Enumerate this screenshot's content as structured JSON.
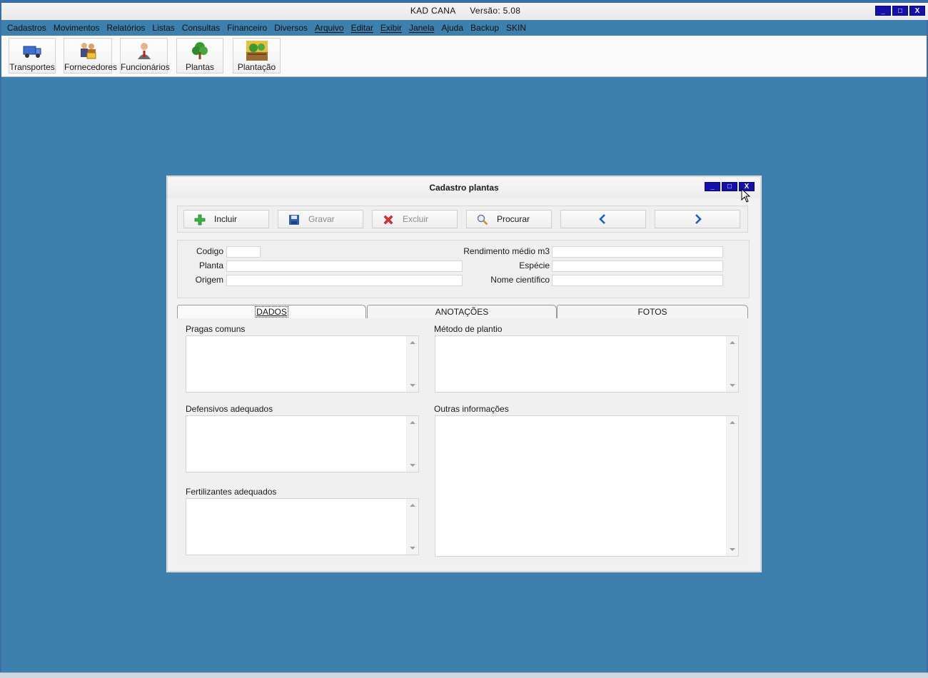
{
  "app": {
    "name": "KAD CANA",
    "version": "Versão: 5.08",
    "controls": {
      "minimize": "_",
      "maximize": "□",
      "close": "X"
    }
  },
  "menu": {
    "items": [
      "Cadastros",
      "Movimentos",
      "Relatórios",
      "Listas",
      "Consultas",
      "Financeiro",
      "Diversos",
      "Arquivo",
      "Editar",
      "Exibir",
      "Janela",
      "Ajuda",
      "Backup",
      "SKIN"
    ]
  },
  "toolbar": {
    "buttons": [
      {
        "label": "Transportes",
        "icon": "truck-icon"
      },
      {
        "label": "Fornecedores",
        "icon": "suppliers-icon"
      },
      {
        "label": "Funcionários",
        "icon": "employee-icon"
      },
      {
        "label": "Plantas",
        "icon": "tree-icon"
      },
      {
        "label": "Plantação",
        "icon": "plantation-icon"
      }
    ]
  },
  "dialog": {
    "title": "Cadastro plantas",
    "actions": {
      "incluir": "Incluir",
      "gravar": "Gravar",
      "excluir": "Excluir",
      "procurar": "Procurar"
    },
    "fields": {
      "codigo": {
        "label": "Codigo",
        "value": ""
      },
      "planta": {
        "label": "Planta",
        "value": ""
      },
      "origem": {
        "label": "Origem",
        "value": ""
      },
      "rendimento": {
        "label": "Rendimento médio m3",
        "value": ""
      },
      "especie": {
        "label": "Espécie",
        "value": ""
      },
      "nome_cientifico": {
        "label": "Nome científico",
        "value": ""
      }
    },
    "tabs": [
      "DADOS",
      "ANOTAÇÕES",
      "FOTOS"
    ],
    "active_tab": "DADOS",
    "dados": {
      "pragas": "Pragas comuns",
      "metodo": "Método de plantio",
      "defensivos": "Defensivos adequados",
      "outras": "Outras informações",
      "fertilizantes": "Fertilizantes adequados"
    }
  },
  "colors": {
    "desktop": "#3d7fad",
    "title_button": "#1410a8"
  }
}
